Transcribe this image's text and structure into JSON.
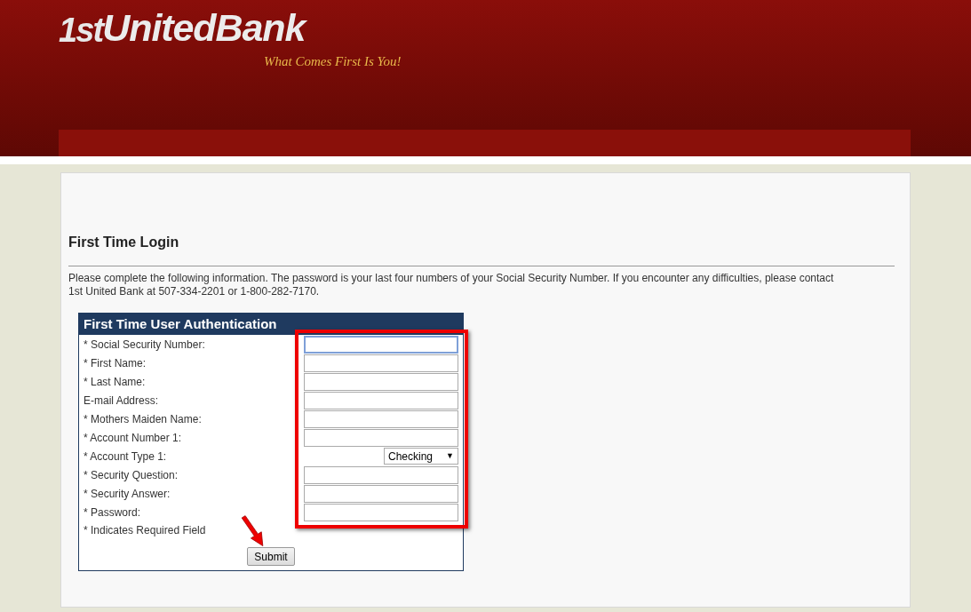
{
  "header": {
    "logo_mark": "1st",
    "logo_name": "UnitedBank",
    "tagline": "What Comes First Is You!"
  },
  "page": {
    "heading": "First Time Login",
    "intro": "Please complete the following information. The password is your last four numbers of your Social Security Number. If you encounter any difficulties, please contact 1st United Bank at 507-334-2201 or 1-800-282-7170."
  },
  "form": {
    "title": "First Time User Authentication",
    "fields": [
      {
        "label": "* Social Security Number:",
        "kind": "text",
        "focused": true
      },
      {
        "label": "* First Name:",
        "kind": "text",
        "focused": false
      },
      {
        "label": "* Last Name:",
        "kind": "text",
        "focused": false
      },
      {
        "label": "E-mail Address:",
        "kind": "text",
        "focused": false
      },
      {
        "label": "* Mothers Maiden Name:",
        "kind": "text",
        "focused": false
      },
      {
        "label": "* Account Number 1:",
        "kind": "text",
        "focused": false
      },
      {
        "label": "* Account Type 1:",
        "kind": "select",
        "value": "Checking",
        "caret": "▼",
        "focused": false
      },
      {
        "label": "* Security Question:",
        "kind": "text",
        "focused": false
      },
      {
        "label": "* Security Answer:",
        "kind": "text",
        "focused": false
      },
      {
        "label": "* Password:",
        "kind": "text",
        "focused": false
      }
    ],
    "note": "* Indicates Required Field",
    "submit": "Submit"
  }
}
